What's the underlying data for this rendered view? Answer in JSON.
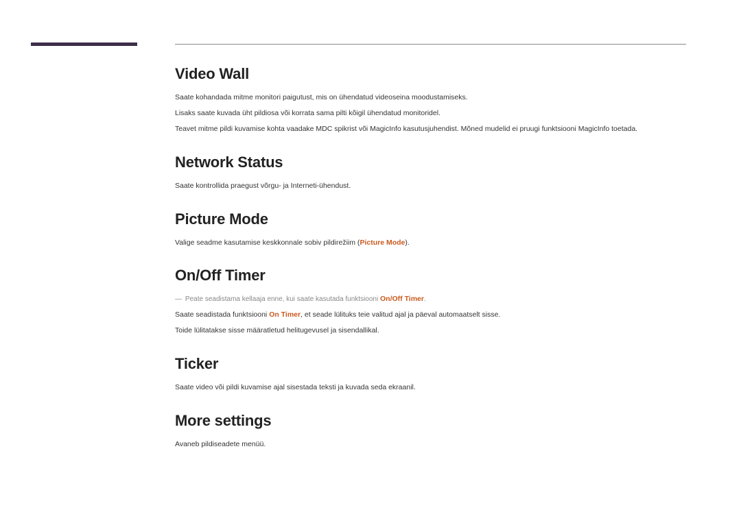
{
  "sections": {
    "videoWall": {
      "heading": "Video Wall",
      "p1": "Saate kohandada mitme monitori paigutust, mis on ühendatud videoseina moodustamiseks.",
      "p2": "Lisaks saate kuvada üht pildiosa või korrata sama pilti kõigil ühendatud monitoridel.",
      "p3": "Teavet mitme pildi kuvamise kohta vaadake MDC spikrist või MagicInfo kasutusjuhendist. Mõned mudelid ei pruugi funktsiooni MagicInfo toetada."
    },
    "networkStatus": {
      "heading": "Network Status",
      "p1": "Saate kontrollida praegust võrgu- ja Interneti-ühendust."
    },
    "pictureMode": {
      "heading": "Picture Mode",
      "p1_pre": "Valige seadme kasutamise keskkonnale sobiv pildirežiim (",
      "p1_highlight": "Picture Mode",
      "p1_post": ")."
    },
    "onOffTimer": {
      "heading": "On/Off Timer",
      "note_pre": "Peate seadistama kellaaja enne, kui saate kasutada funktsiooni ",
      "note_highlight": "On/Off Timer",
      "note_post": ".",
      "p1_pre": "Saate seadistada funktsiooni ",
      "p1_highlight": "On Timer",
      "p1_post": ", et seade lülituks teie valitud ajal ja päeval automaatselt sisse.",
      "p2": "Toide lülitatakse sisse määratletud helitugevusel ja sisendallikal."
    },
    "ticker": {
      "heading": "Ticker",
      "p1": "Saate video või pildi kuvamise ajal sisestada teksti ja kuvada seda ekraanil."
    },
    "moreSettings": {
      "heading": "More settings",
      "p1": "Avaneb pildiseadete menüü."
    }
  }
}
